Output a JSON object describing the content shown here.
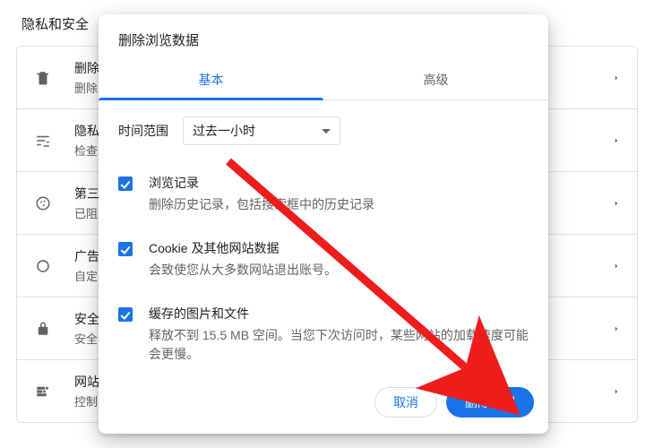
{
  "page": {
    "title": "隐私和安全"
  },
  "rows": [
    {
      "icon": "trash",
      "title": "删除",
      "sub": "删除"
    },
    {
      "icon": "tune",
      "title": "隐私",
      "sub": "检查"
    },
    {
      "icon": "cookie",
      "title": "第三",
      "sub": "已阻"
    },
    {
      "icon": "ads",
      "title": "广告",
      "sub": "自定"
    },
    {
      "icon": "lock",
      "title": "安全",
      "sub": "安全"
    },
    {
      "icon": "site",
      "title": "网站",
      "sub": "控制"
    }
  ],
  "dialog": {
    "title": "删除浏览数据",
    "tabs": {
      "basic": "基本",
      "advanced": "高级"
    },
    "range_label": "时间范围",
    "range_value": "过去一小时",
    "items": [
      {
        "title": "浏览记录",
        "sub": "删除历史记录，包括搜索框中的历史记录"
      },
      {
        "title": "Cookie 及其他网站数据",
        "sub": "会致使您从大多数网站退出账号。"
      },
      {
        "title": "缓存的图片和文件",
        "sub": "释放不到 15.5 MB 空间。当您下次访问时，某些网站的加载速度可能会更慢。"
      }
    ],
    "cancel": "取消",
    "confirm": "删除数据"
  }
}
